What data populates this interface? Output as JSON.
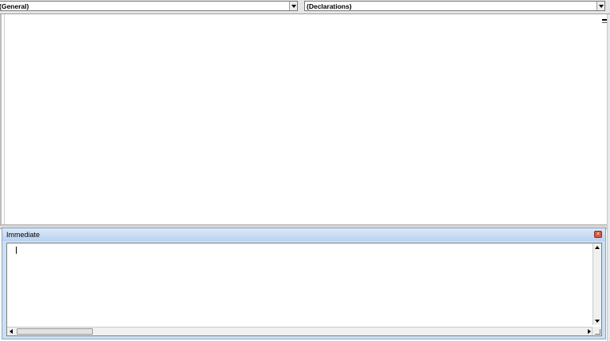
{
  "code_window": {
    "object_combo": {
      "value": "(General)"
    },
    "procedure_combo": {
      "value": "(Declarations)"
    }
  },
  "immediate_window": {
    "title": "Immediate",
    "content": ""
  },
  "colors": {
    "title_bar": "#b9d2ee",
    "close_button": "#d35745",
    "frame": "#cde0f3"
  }
}
